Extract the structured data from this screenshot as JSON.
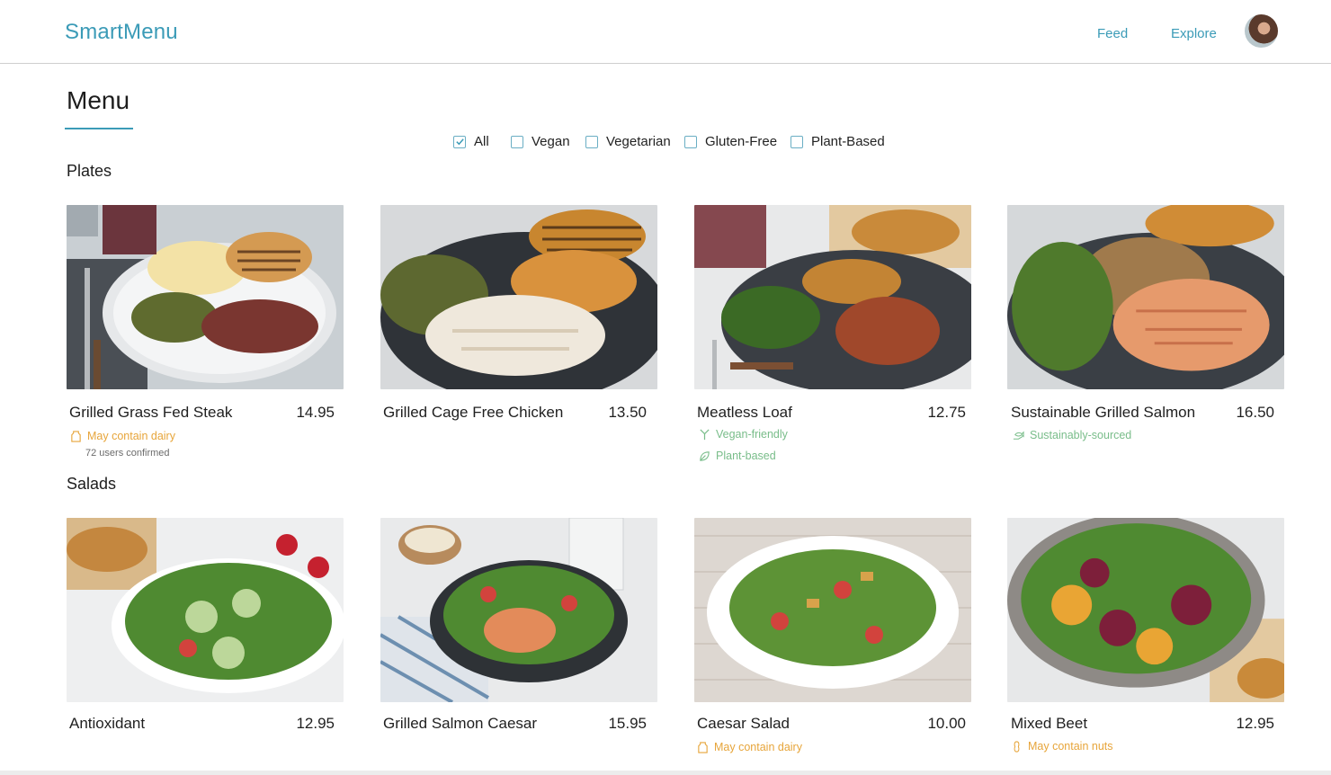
{
  "header": {
    "brand": "SmartMenu",
    "nav": {
      "feed": "Feed",
      "explore": "Explore"
    }
  },
  "page": {
    "title": "Menu"
  },
  "filters": [
    {
      "label": "All",
      "checked": true
    },
    {
      "label": "Vegan",
      "checked": false
    },
    {
      "label": "Vegetarian",
      "checked": false
    },
    {
      "label": "Gluten-Free",
      "checked": false
    },
    {
      "label": "Plant-Based",
      "checked": false
    }
  ],
  "sections": {
    "plates": {
      "title": "Plates",
      "items": [
        {
          "name": "Grilled Grass Fed Steak",
          "price": "14.95",
          "tags": [
            "May contain dairy"
          ],
          "confirmed": "72 users confirmed"
        },
        {
          "name": "Grilled Cage Free Chicken",
          "price": "13.50"
        },
        {
          "name": "Meatless Loaf",
          "price": "12.75",
          "tags": [
            "Vegan-friendly",
            "Plant-based"
          ]
        },
        {
          "name": "Sustainable Grilled Salmon",
          "price": "16.50",
          "tags": [
            "Sustainably-sourced"
          ]
        }
      ]
    },
    "salads": {
      "title": "Salads",
      "items": [
        {
          "name": "Antioxidant",
          "price": "12.95"
        },
        {
          "name": "Grilled Salmon Caesar",
          "price": "15.95"
        },
        {
          "name": "Caesar Salad",
          "price": "10.00",
          "tags": [
            "May contain dairy"
          ]
        },
        {
          "name": "Mixed Beet",
          "price": "12.95",
          "tags": [
            "May contain nuts"
          ]
        }
      ]
    }
  },
  "colors": {
    "accent": "#3b9bb7",
    "warning_tag": "#e7a53a",
    "positive_tag": "#79bd8a"
  },
  "icons": {
    "dairy": "milk-carton-icon",
    "nuts": "peanut-icon",
    "vegan": "sprout-icon",
    "plant": "leaf-icon",
    "sustainable": "fish-hand-icon",
    "checkbox_checked": "check-icon"
  }
}
